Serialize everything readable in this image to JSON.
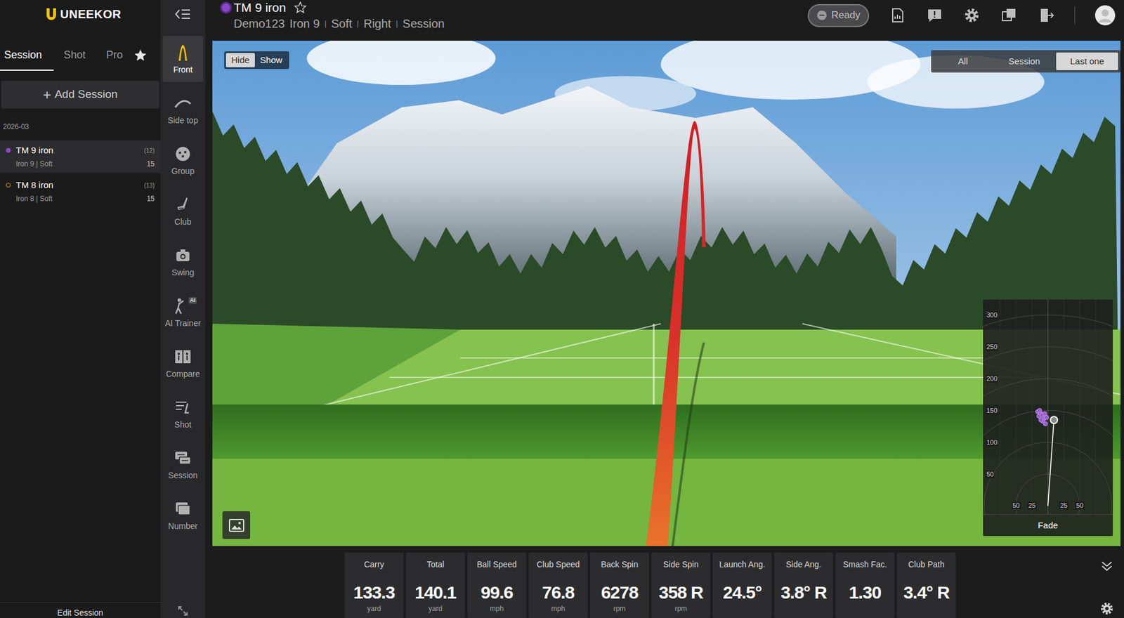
{
  "logo": "UNEEKOR",
  "left_tabs": [
    {
      "label": "Session",
      "selected": true
    },
    {
      "label": "Shot",
      "selected": false
    },
    {
      "label": "Pro",
      "selected": false
    }
  ],
  "add_session": {
    "icon": "+",
    "label": "Add Session"
  },
  "session_group": "2026-03",
  "sessions": [
    {
      "title": "TM 9 iron",
      "count": "(12)",
      "detail": "Iron 9 | Soft",
      "shots": "15",
      "selected": true,
      "kind": "filled",
      "color": "#8b45c8"
    },
    {
      "title": "TM 8 iron",
      "count": "(13)",
      "detail": "Iron 8 | Soft",
      "shots": "15",
      "selected": false,
      "kind": "hollow",
      "color": "#e0a030"
    }
  ],
  "edit_session": "Edit Session",
  "rail": [
    {
      "label": "Front",
      "selected": true
    },
    {
      "label": "Side top",
      "selected": false
    },
    {
      "label": "Group",
      "selected": false
    },
    {
      "label": "Club",
      "selected": false
    },
    {
      "label": "Swing",
      "selected": false
    },
    {
      "label": "AI Trainer",
      "selected": false,
      "badge": "AI"
    },
    {
      "label": "Compare",
      "selected": false
    },
    {
      "label": "Shot",
      "selected": false
    },
    {
      "label": "Session",
      "selected": false
    },
    {
      "label": "Number",
      "selected": false
    }
  ],
  "header": {
    "title": "TM 9 iron",
    "color": "#8b45c8",
    "favorite": false,
    "subtitle": [
      {
        "text": "Demo123",
        "kind": "item"
      },
      {
        "text": "Iron 9",
        "kind": "item"
      },
      {
        "text": "|",
        "kind": "separator"
      },
      {
        "text": "Soft",
        "kind": "item"
      },
      {
        "text": "|",
        "kind": "separator"
      },
      {
        "text": "Right",
        "kind": "item"
      },
      {
        "text": "|",
        "kind": "separator"
      },
      {
        "text": "Session",
        "kind": "item"
      }
    ]
  },
  "status": {
    "label": "Ready",
    "disabled": true
  },
  "view_toggle": [
    {
      "label": "Hide",
      "selected": true
    },
    {
      "label": "Show",
      "selected": false
    }
  ],
  "shot_filter": [
    {
      "label": "All",
      "selected": false
    },
    {
      "label": "Session",
      "selected": false
    },
    {
      "label": "Last one",
      "selected": true
    }
  ],
  "dispersion": {
    "y_ticks": [
      "300",
      "250",
      "200",
      "150",
      "100",
      "50"
    ],
    "x_ticks": [
      "50",
      "25",
      "25",
      "50"
    ],
    "shots": [
      {
        "side": -16,
        "carry": 148,
        "selected": false
      },
      {
        "side": -12,
        "carry": 146,
        "selected": false
      },
      {
        "side": -14,
        "carry": 141,
        "selected": false
      },
      {
        "side": -9,
        "carry": 143,
        "selected": false
      },
      {
        "side": -6,
        "carry": 137,
        "selected": false
      },
      {
        "side": -8,
        "carry": 133,
        "selected": false
      },
      {
        "side": -4,
        "carry": 129,
        "selected": false
      },
      {
        "side": -2,
        "carry": 139,
        "selected": false
      },
      {
        "side": -11,
        "carry": 135,
        "selected": false
      },
      {
        "side": -5,
        "carry": 145,
        "selected": false
      },
      {
        "side": -13,
        "carry": 150,
        "selected": false
      },
      {
        "side": 9.5,
        "carry": 135,
        "selected": true
      }
    ],
    "shape": "Fade"
  },
  "metrics": [
    {
      "label": "Carry",
      "value": "133.3",
      "unit": "yard"
    },
    {
      "label": "Total",
      "value": "140.1",
      "unit": "yard"
    },
    {
      "label": "Ball Speed",
      "value": "99.6",
      "unit": "mph"
    },
    {
      "label": "Club Speed",
      "value": "76.8",
      "unit": "mph"
    },
    {
      "label": "Back Spin",
      "value": "6278",
      "unit": "rpm"
    },
    {
      "label": "Side Spin",
      "value": "358 R",
      "unit": "rpm"
    },
    {
      "label": "Launch Ang.",
      "value": "24.5°"
    },
    {
      "label": "Side Ang.",
      "value": "3.8° R"
    },
    {
      "label": "Smash Fac.",
      "value": "1.30"
    },
    {
      "label": "Club Path",
      "value": "3.4° R"
    }
  ]
}
